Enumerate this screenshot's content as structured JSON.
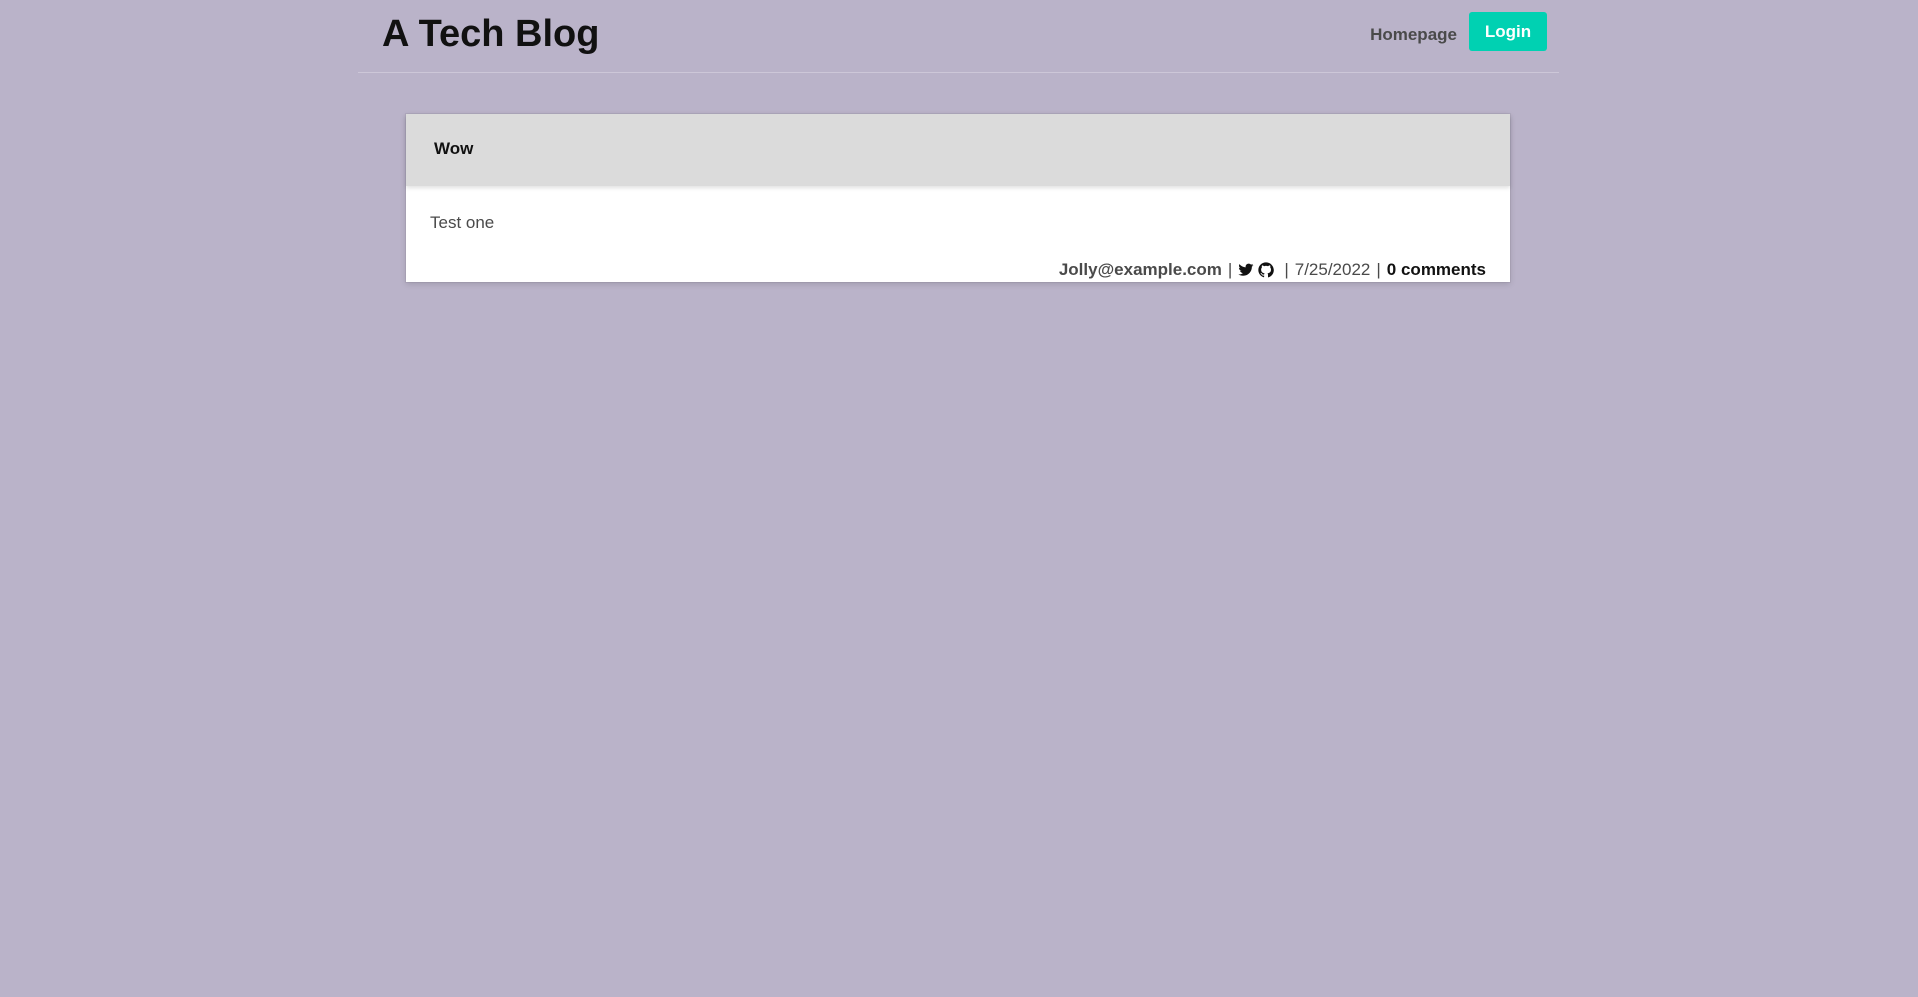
{
  "header": {
    "site_title": "A Tech Blog",
    "nav": {
      "homepage_label": "Homepage",
      "login_label": "Login"
    }
  },
  "post": {
    "title": "Wow",
    "body": "Test one",
    "meta": {
      "author": "Jolly@example.com",
      "separator": "|",
      "icons": [
        "twitter-icon",
        "github-icon"
      ],
      "date": "7/25/2022",
      "comments": "0 comments"
    }
  },
  "colors": {
    "background": "#bab3c9",
    "primary": "#00d1b2",
    "card_header": "#dbdbdb"
  }
}
